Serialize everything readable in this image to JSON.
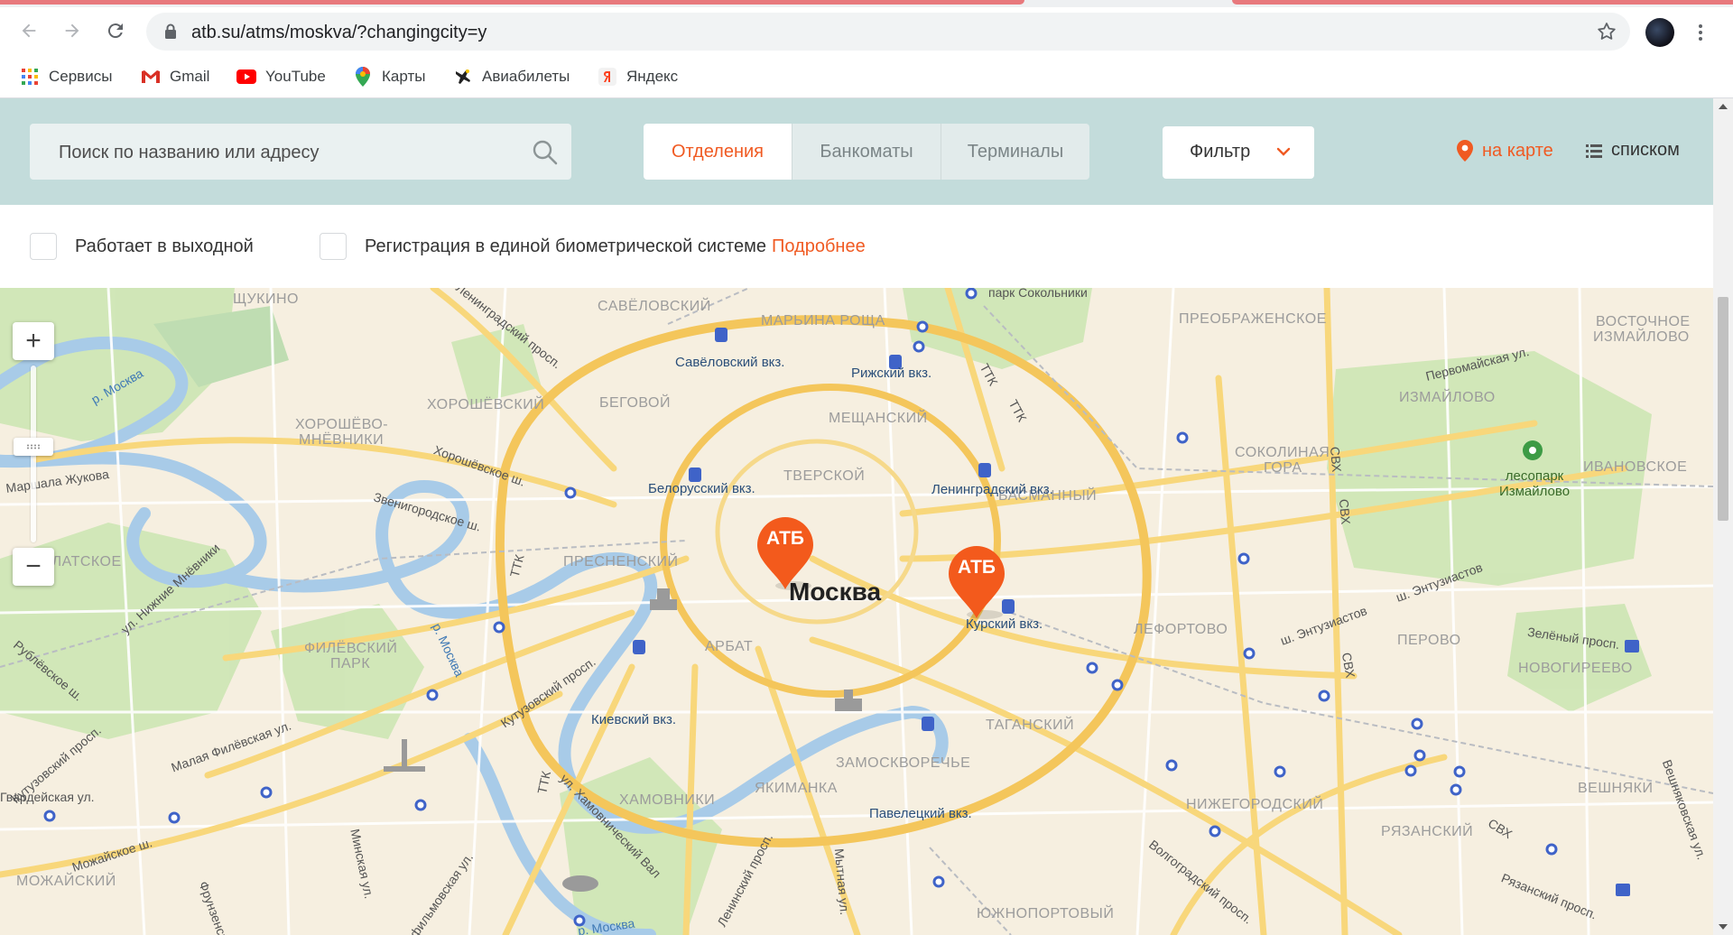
{
  "browser": {
    "url": "atb.su/atms/moskva/?changingcity=y",
    "bookmarks": [
      {
        "label": "Сервисы",
        "icon": "apps-grid-icon"
      },
      {
        "label": "Gmail",
        "icon": "gmail-icon"
      },
      {
        "label": "YouTube",
        "icon": "youtube-icon"
      },
      {
        "label": "Карты",
        "icon": "maps-pin-icon"
      },
      {
        "label": "Авиабилеты",
        "icon": "plane-icon"
      },
      {
        "label": "Яндекс",
        "icon": "yandex-icon"
      }
    ]
  },
  "header": {
    "search_placeholder": "Поиск по названию или адресу",
    "tabs": [
      {
        "label": "Отделения",
        "active": true
      },
      {
        "label": "Банкоматы",
        "active": false
      },
      {
        "label": "Терминалы",
        "active": false
      }
    ],
    "filter_label": "Фильтр",
    "view_map_label": "на карте",
    "view_list_label": "списком",
    "accent_color": "#f05a22"
  },
  "filters": {
    "weekend_label": "Работает в выходной",
    "biometric_label": "Регистрация в единой биометрической системе",
    "more_link": "Подробнее"
  },
  "map": {
    "city_label": "Москва",
    "marker_label": "АТБ",
    "zoom_in": "+",
    "zoom_out": "−",
    "districts": [
      "ЩУКИНО",
      "САВЁЛОВСКИЙ",
      "МАРЬИНА РОЩА",
      "ПРЕОБРАЖЕНСКОЕ",
      "ВОСТОЧНОЕ",
      "ИЗМАЙЛОВО",
      "ХОРОШЁВСКИЙ",
      "БЕГОВОЙ",
      "ХОРОШЁВО-",
      "МНЁВНИКИ",
      "МЕЩАНСКИЙ",
      "ИЗМАЙЛОВО",
      "ТВЕРСКОЙ",
      "БАСМАННЫЙ",
      "СОКОЛИНАЯ",
      "ГОРА",
      "ИВАНОВСКОЕ",
      "КРЫЛАТСКОЕ",
      "ПРЕСНЕНСКИЙ",
      "ЛЕФОРТОВО",
      "ПЕРОВО",
      "НОВОГИРЕЕВО",
      "ФИЛЁВСКИЙ",
      "ПАРК",
      "АРБАТ",
      "ТАГАНСКИЙ",
      "ЗАМОСКВОРЕЧЬЕ",
      "ВЕШНЯКИ",
      "ХАМОВНИКИ",
      "ЯКИМАНКА",
      "НИЖЕГОРОДСКИЙ",
      "РЯЗАНСКИЙ",
      "МОЖАЙСКИЙ",
      "ЮЖНОПОРТОВЫЙ"
    ],
    "stations": [
      "Савёловский вкз.",
      "Рижский вкз.",
      "Белорусский вкз.",
      "Ленинградский вкз.",
      "Курский вкз.",
      "Киевский вкз.",
      "Павелецкий вкз."
    ],
    "streets": [
      "Ленинградский просп.",
      "р. Москва",
      "Маршала Жукова",
      "Хорошёвское ш.",
      "Звенигородское ш.",
      "ТТК",
      "ТТК",
      "ТТК",
      "ТТК",
      "СВХ",
      "СВХ",
      "СВХ",
      "СВХ",
      "Первомайская ул.",
      "ш. Энтузиастов",
      "ш. Энтузиастов",
      "Зелёный просп.",
      "ул. Нижние Мнёвники",
      "Рублёвское ш.",
      "р. Москва",
      "Кутузовский просп.",
      "Малая Филёвская ул.",
      "Гвардейская ул.",
      "Минская ул.",
      "Можайское ш.",
      "ул. Хамовнический Вал",
      "Ленинский просп.",
      "Мытная ул.",
      "Волгоградский просп.",
      "Рязанский просп.",
      "Вешняковская ул.",
      "Фрунзенская ул.",
      "Кутузовский просп.",
      "Бофильмовская ул.",
      "парк Сокольники",
      "р. Москва"
    ],
    "park_label": "лесопарк Измайлово"
  }
}
